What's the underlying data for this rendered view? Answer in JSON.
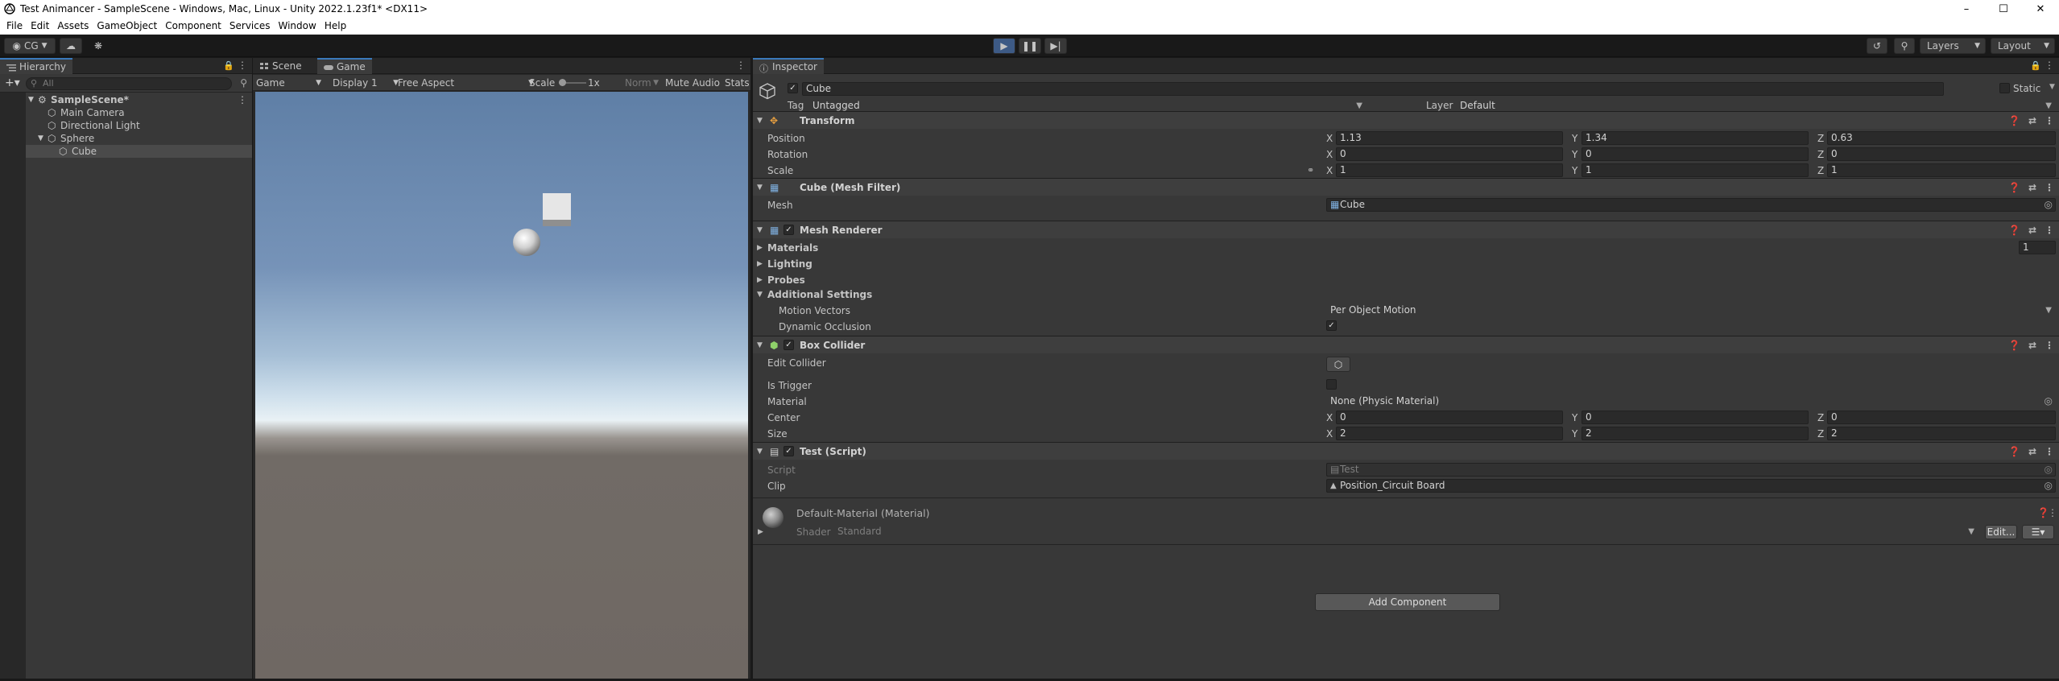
{
  "window": {
    "title": "Test Animancer - SampleScene - Windows, Mac, Linux - Unity 2022.1.23f1* <DX11>"
  },
  "menu": [
    "File",
    "Edit",
    "Assets",
    "GameObject",
    "Component",
    "Services",
    "Window",
    "Help"
  ],
  "toolbar": {
    "account": "CG",
    "layers": "Layers",
    "layout": "Layout"
  },
  "hierarchy": {
    "tab": "Hierarchy",
    "search_placeholder": "All",
    "items": [
      {
        "label": "SampleScene*",
        "depth": 0
      },
      {
        "label": "Main Camera",
        "depth": 1
      },
      {
        "label": "Directional Light",
        "depth": 1
      },
      {
        "label": "Sphere",
        "depth": 1
      },
      {
        "label": "Cube",
        "depth": 2
      }
    ]
  },
  "game_view": {
    "tabs": [
      "Scene",
      "Game"
    ],
    "mode": "Game",
    "display": "Display 1",
    "aspect": "Free Aspect",
    "scale_label": "Scale",
    "scale_value": "1x",
    "norm": "Norm",
    "mute_audio": "Mute Audio",
    "stats": "Stats"
  },
  "inspector": {
    "tab": "Inspector",
    "object_name": "Cube",
    "static_label": "Static",
    "tag_label": "Tag",
    "tag_value": "Untagged",
    "layer_label": "Layer",
    "layer_value": "Default",
    "transform": {
      "title": "Transform",
      "position_label": "Position",
      "position": {
        "x": "1.13",
        "y": "1.34",
        "z": "0.63"
      },
      "rotation_label": "Rotation",
      "rotation": {
        "x": "0",
        "y": "0",
        "z": "0"
      },
      "scale_label": "Scale",
      "scale": {
        "x": "1",
        "y": "1",
        "z": "1"
      }
    },
    "mesh_filter": {
      "title": "Cube (Mesh Filter)",
      "mesh_label": "Mesh",
      "mesh_value": "Cube"
    },
    "mesh_renderer": {
      "title": "Mesh Renderer",
      "materials": "Materials",
      "materials_count": "1",
      "lighting": "Lighting",
      "probes": "Probes",
      "additional_settings": "Additional Settings",
      "motion_vectors_label": "Motion Vectors",
      "motion_vectors_value": "Per Object Motion",
      "dynamic_occlusion_label": "Dynamic Occlusion"
    },
    "box_collider": {
      "title": "Box Collider",
      "edit_collider": "Edit Collider",
      "is_trigger": "Is Trigger",
      "material_label": "Material",
      "material_value": "None (Physic Material)",
      "center_label": "Center",
      "center": {
        "x": "0",
        "y": "0",
        "z": "0"
      },
      "size_label": "Size",
      "size": {
        "x": "2",
        "y": "2",
        "z": "2"
      }
    },
    "test_script": {
      "title": "Test (Script)",
      "script_label": "Script",
      "script_value": "Test",
      "clip_label": "Clip",
      "clip_value": "Position_Circuit Board"
    },
    "material": {
      "title": "Default-Material (Material)",
      "shader_label": "Shader",
      "shader_value": "Standard",
      "edit_button": "Edit..."
    },
    "add_component": "Add Component",
    "axis_labels": {
      "x": "X",
      "y": "Y",
      "z": "Z"
    }
  },
  "colors": {
    "accent": "#3a79bb",
    "panel": "#383838",
    "header": "#3e3e3e",
    "field": "#2a2a2a"
  }
}
